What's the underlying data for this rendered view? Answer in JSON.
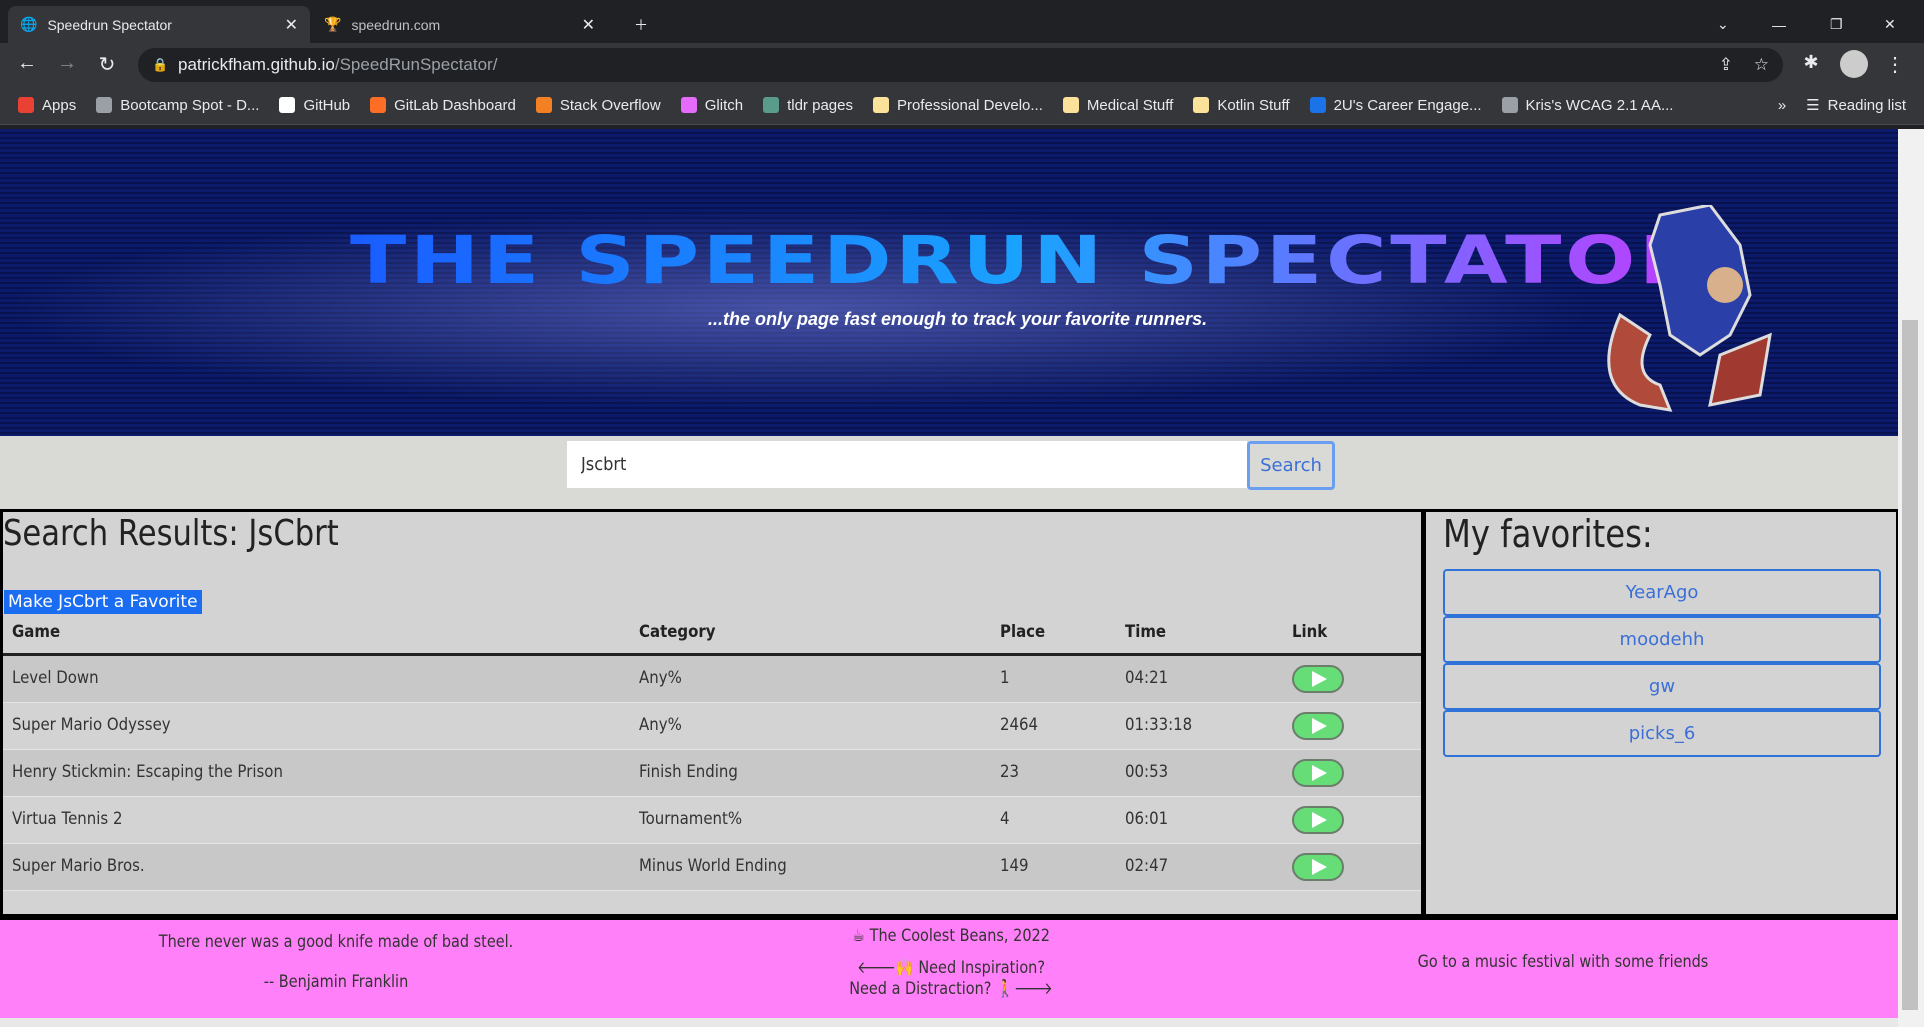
{
  "browser": {
    "tabs": [
      {
        "title": "Speedrun Spectator",
        "active": true
      },
      {
        "title": "speedrun.com",
        "active": false
      }
    ],
    "url_host": "patrickfham.github.io",
    "url_path": "/SpeedRunSpectator/",
    "bookmarks": [
      {
        "label": "Apps",
        "color": "#e94235"
      },
      {
        "label": "Bootcamp Spot - D...",
        "color": "#9aa0a6"
      },
      {
        "label": "GitHub",
        "color": "#ffffff"
      },
      {
        "label": "GitLab Dashboard",
        "color": "#fc6d26"
      },
      {
        "label": "Stack Overflow",
        "color": "#f48024"
      },
      {
        "label": "Glitch",
        "color": "#e56bfa"
      },
      {
        "label": "tldr pages",
        "color": "#5a9c8c"
      },
      {
        "label": "Professional Develo...",
        "color": "#fbe19a"
      },
      {
        "label": "Medical Stuff",
        "color": "#fbe19a"
      },
      {
        "label": "Kotlin Stuff",
        "color": "#fbe19a"
      },
      {
        "label": "2U's Career Engage...",
        "color": "#1a73e8"
      },
      {
        "label": "Kris's WCAG 2.1 AA...",
        "color": "#9aa0a6"
      }
    ],
    "reading_list": "Reading list"
  },
  "banner": {
    "title": "THE SPEEDRUN SPECTATOR",
    "subtitle": "...the only page fast enough to track your favorite runners."
  },
  "search": {
    "value": "Jscbrt",
    "button": "Search"
  },
  "results": {
    "heading": "Search Results: JsCbrt",
    "favorite_button": "Make JsCbrt a Favorite",
    "columns": [
      "Game",
      "Category",
      "Place",
      "Time",
      "Link"
    ],
    "rows": [
      {
        "game": "Level Down",
        "category": "Any%",
        "place": "1",
        "time": "04:21"
      },
      {
        "game": "Super Mario Odyssey",
        "category": "Any%",
        "place": "2464",
        "time": "01:33:18"
      },
      {
        "game": "Henry Stickmin: Escaping the Prison",
        "category": "Finish Ending",
        "place": "23",
        "time": "00:53"
      },
      {
        "game": "Virtua Tennis 2",
        "category": "Tournament%",
        "place": "4",
        "time": "06:01"
      },
      {
        "game": "Super Mario Bros.",
        "category": "Minus World Ending",
        "place": "149",
        "time": "02:47"
      }
    ]
  },
  "favorites": {
    "title": "My favorites:",
    "items": [
      "YearAgo",
      "moodehh",
      "gw",
      "picks_6"
    ]
  },
  "footer": {
    "quote": "There never was a good knife made of bad steel.",
    "author": "-- Benjamin Franklin",
    "copyright": "The Coolest Beans, 2022",
    "inspiration": "Need Inspiration?",
    "distraction": "Need a Distraction?",
    "activity": "Go to a music festival with some friends"
  },
  "colors": {
    "footer": "#ff80f8",
    "accent": "#2f73d9",
    "play": "#66dd77"
  }
}
